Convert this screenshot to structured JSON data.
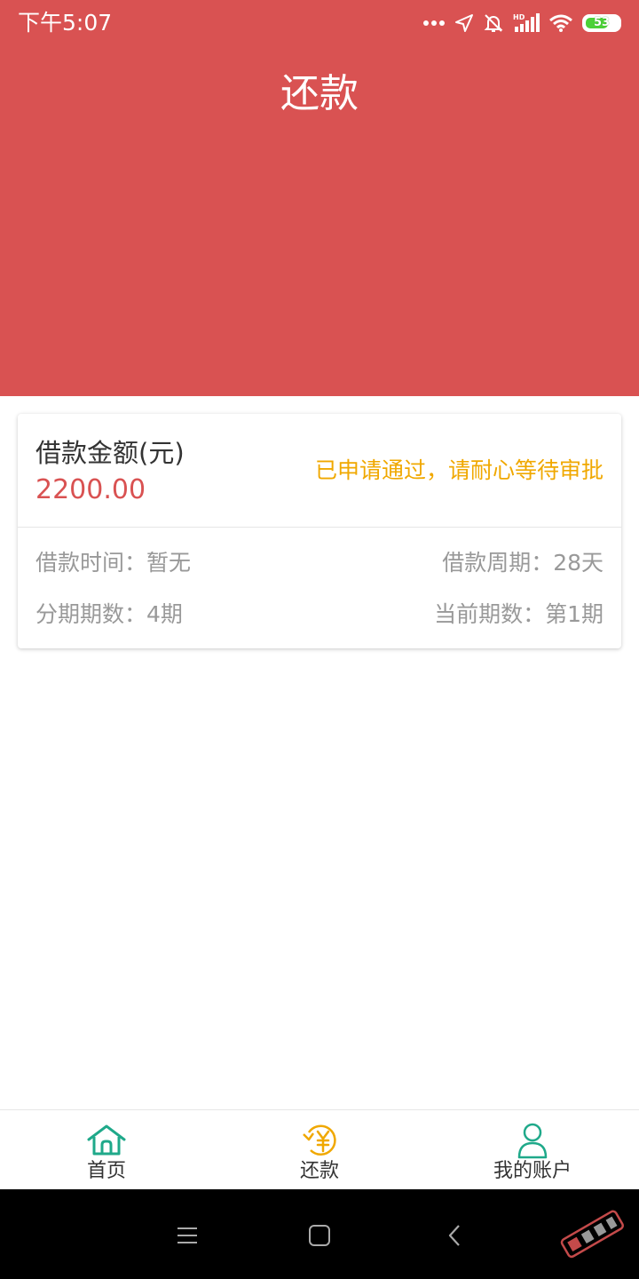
{
  "status_bar": {
    "time": "下午5:07",
    "battery": "53",
    "battery_color": "#4cd137"
  },
  "header": {
    "title": "还款",
    "background": "#d95252"
  },
  "loan_card": {
    "amount_label": "借款金额(元)",
    "amount_value": "2200.00",
    "status_message": "已申请通过，请耐心等待审批",
    "status_color": "#f0a800",
    "details": {
      "loan_time": "借款时间：暂无",
      "loan_period": "借款周期：28天",
      "installments": "分期期数：4期",
      "current_installment": "当前期数：第1期"
    }
  },
  "bottom_nav": {
    "items": [
      {
        "label": "首页",
        "icon": "home-icon"
      },
      {
        "label": "还款",
        "icon": "repay-yuan-icon"
      },
      {
        "label": "我的账户",
        "icon": "user-icon"
      }
    ]
  },
  "system_nav": {
    "icons": [
      "menu-icon",
      "home-square-icon",
      "back-icon"
    ]
  }
}
